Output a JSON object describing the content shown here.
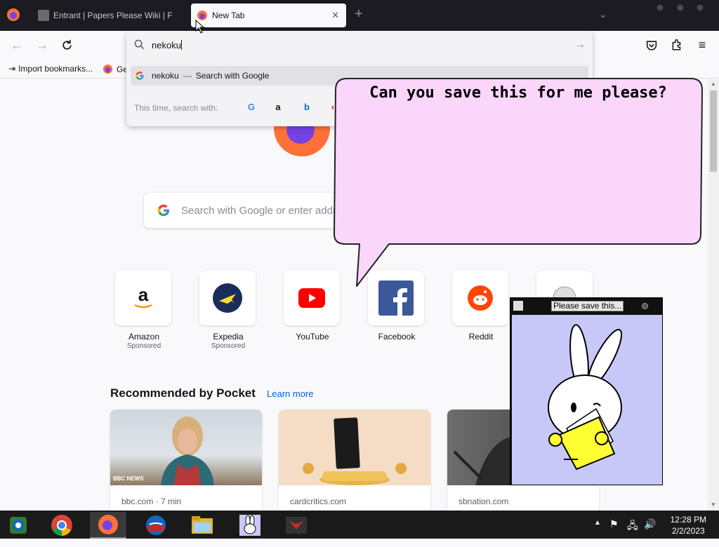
{
  "browser": {
    "tabs": [
      {
        "title": "Entrant | Papers Please Wiki | F",
        "active": false
      },
      {
        "title": "New Tab",
        "active": true
      }
    ],
    "url_input": "nekoku",
    "suggestion": {
      "query": "nekoku",
      "action": "Search with Google"
    },
    "one_off_label": "This time, search with:",
    "bookmarks": [
      {
        "label": "Import bookmarks..."
      },
      {
        "label": "Ge"
      }
    ]
  },
  "newtab": {
    "search_placeholder": "Search with Google or enter addr",
    "top_sites": [
      {
        "name": "Amazon",
        "sub": "Sponsored"
      },
      {
        "name": "Expedia",
        "sub": "Sponsored"
      },
      {
        "name": "YouTube",
        "sub": ""
      },
      {
        "name": "Facebook",
        "sub": ""
      },
      {
        "name": "Reddit",
        "sub": ""
      }
    ],
    "pocket": {
      "heading": "Recommended by Pocket",
      "learn_more": "Learn more",
      "cards": [
        {
          "source": "bbc.com · 7 min",
          "badge": "BBC NEWS"
        },
        {
          "source": "cardcritics.com"
        },
        {
          "source": "sbnation.com"
        }
      ]
    }
  },
  "overlay": {
    "bubble_text": "Can you save this for me please?",
    "pet_window_title": "Please save this..."
  },
  "taskbar": {
    "time": "12:28 PM",
    "date": "2/2/2023"
  }
}
